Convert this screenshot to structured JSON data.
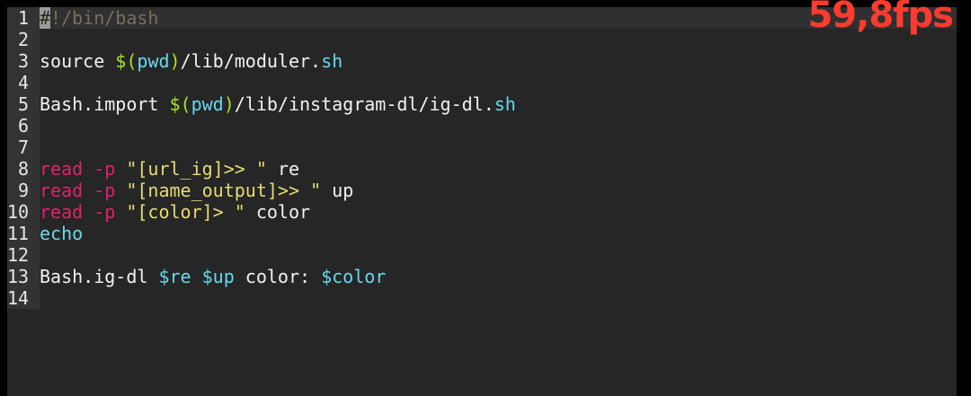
{
  "overlay": {
    "fps": "59,8fps"
  },
  "colors": {
    "background": "#262626",
    "gutter": "#333333",
    "keyword": "#e0226a",
    "string": "#e6db74",
    "variable": "#66d9ef",
    "substitution": "#a6e22e",
    "comment": "#75715e",
    "fps": "#ff3b30"
  },
  "editor": {
    "lines": [
      {
        "num": "1",
        "tokens": [
          {
            "t": "#",
            "c": "cursor"
          },
          {
            "t": "!/bin/bash",
            "c": "comment"
          }
        ]
      },
      {
        "num": "2",
        "tokens": []
      },
      {
        "num": "3",
        "tokens": [
          {
            "t": "source ",
            "c": "plain"
          },
          {
            "t": "$(",
            "c": "sub"
          },
          {
            "t": "pwd",
            "c": "var"
          },
          {
            "t": ")",
            "c": "sub"
          },
          {
            "t": "/lib/moduler.",
            "c": "plain"
          },
          {
            "t": "sh",
            "c": "var"
          }
        ]
      },
      {
        "num": "4",
        "tokens": []
      },
      {
        "num": "5",
        "tokens": [
          {
            "t": "Bash.import ",
            "c": "plain"
          },
          {
            "t": "$(",
            "c": "sub"
          },
          {
            "t": "pwd",
            "c": "var"
          },
          {
            "t": ")",
            "c": "sub"
          },
          {
            "t": "/lib/instagram-dl/ig-dl.",
            "c": "plain"
          },
          {
            "t": "sh",
            "c": "var"
          }
        ]
      },
      {
        "num": "6",
        "tokens": []
      },
      {
        "num": "7",
        "tokens": []
      },
      {
        "num": "8",
        "tokens": [
          {
            "t": "read",
            "c": "kw"
          },
          {
            "t": " ",
            "c": "plain"
          },
          {
            "t": "-p",
            "c": "kw"
          },
          {
            "t": " \"[url_ig]>> \"",
            "c": "str"
          },
          {
            "t": " re",
            "c": "plain"
          }
        ]
      },
      {
        "num": "9",
        "tokens": [
          {
            "t": "read",
            "c": "kw"
          },
          {
            "t": " ",
            "c": "plain"
          },
          {
            "t": "-p",
            "c": "kw"
          },
          {
            "t": " \"[name_output]>> \"",
            "c": "str"
          },
          {
            "t": " up",
            "c": "plain"
          }
        ]
      },
      {
        "num": "10",
        "tokens": [
          {
            "t": "read",
            "c": "kw"
          },
          {
            "t": " ",
            "c": "plain"
          },
          {
            "t": "-p",
            "c": "kw"
          },
          {
            "t": " \"[color]> \"",
            "c": "str"
          },
          {
            "t": " color",
            "c": "plain"
          }
        ]
      },
      {
        "num": "11",
        "tokens": [
          {
            "t": "echo",
            "c": "var"
          }
        ]
      },
      {
        "num": "12",
        "tokens": []
      },
      {
        "num": "13",
        "tokens": [
          {
            "t": "Bash.ig-dl ",
            "c": "plain"
          },
          {
            "t": "$re",
            "c": "var"
          },
          {
            "t": " ",
            "c": "plain"
          },
          {
            "t": "$up",
            "c": "var"
          },
          {
            "t": " color: ",
            "c": "plain"
          },
          {
            "t": "$color",
            "c": "var"
          }
        ]
      },
      {
        "num": "14",
        "tokens": []
      }
    ]
  }
}
